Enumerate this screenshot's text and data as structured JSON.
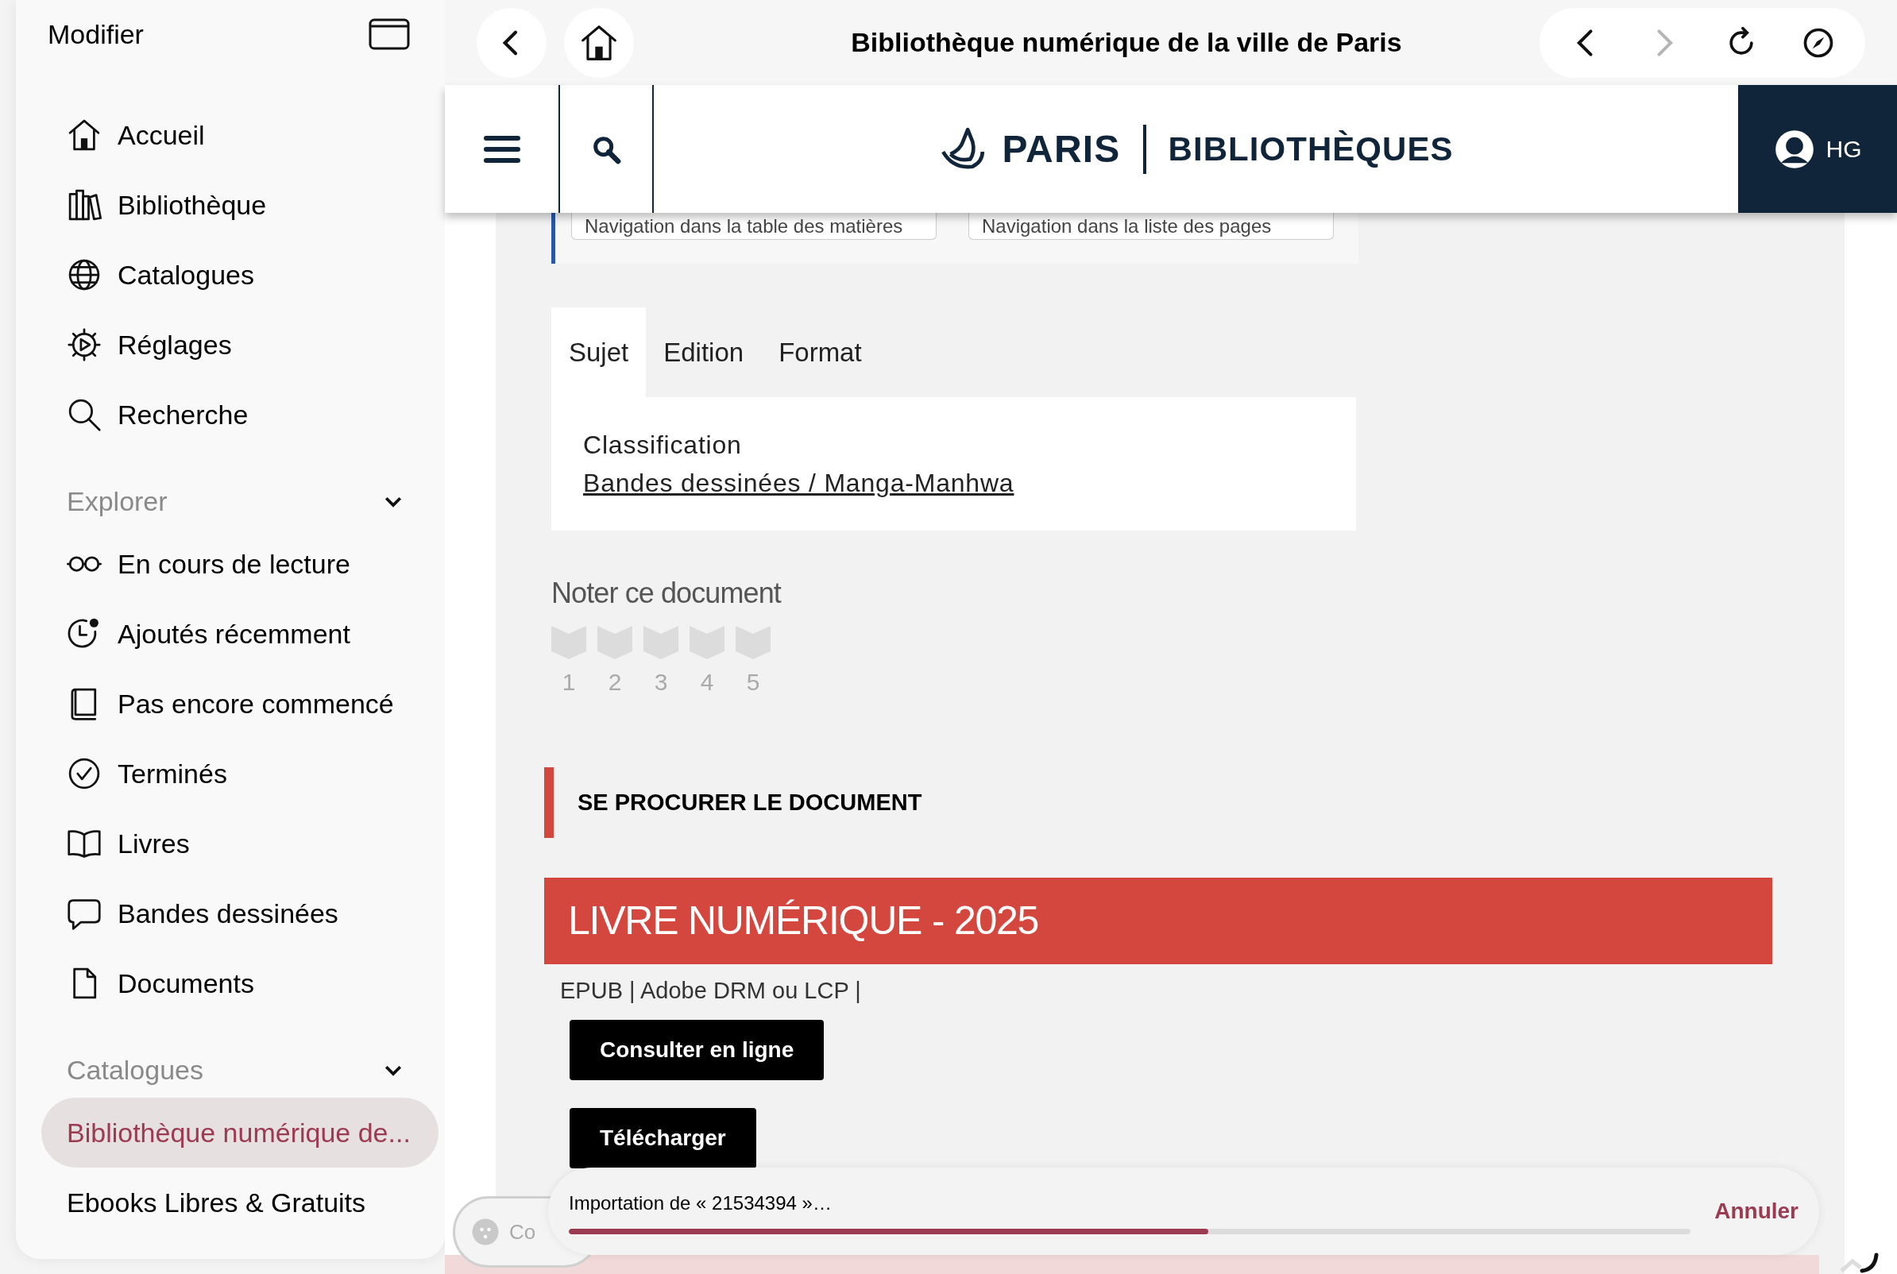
{
  "sidebar": {
    "edit_label": "Modifier",
    "items": [
      {
        "label": "Accueil",
        "kind": "home",
        "selected": false
      },
      {
        "label": "Bibliothèque",
        "kind": "library",
        "selected": false
      },
      {
        "label": "Catalogues",
        "kind": "globe",
        "selected": false
      },
      {
        "label": "Réglages",
        "kind": "gear",
        "selected": false
      },
      {
        "label": "Recherche",
        "kind": "search",
        "selected": false
      }
    ],
    "sections": [
      {
        "title": "Explorer",
        "expanded": true,
        "items": [
          {
            "label": "En cours de lecture",
            "kind": "glasses",
            "selected": false
          },
          {
            "label": "Ajoutés récemment",
            "kind": "clock",
            "selected": false
          },
          {
            "label": "Pas encore commencé",
            "kind": "book",
            "selected": false
          },
          {
            "label": "Terminés",
            "kind": "check",
            "selected": false
          },
          {
            "label": "Livres",
            "kind": "open-book",
            "selected": false
          },
          {
            "label": "Bandes dessinées",
            "kind": "bubble",
            "selected": false
          },
          {
            "label": "Documents",
            "kind": "document",
            "selected": false
          }
        ]
      },
      {
        "title": "Catalogues",
        "expanded": true,
        "items": [
          {
            "label": "Bibliothèque numérique de...",
            "kind": "text",
            "selected": true
          },
          {
            "label": "Ebooks Libres & Gratuits",
            "kind": "text",
            "selected": false
          }
        ]
      }
    ]
  },
  "browser": {
    "title": "Bibliothèque numérique de la ville de Paris",
    "nav": [
      {
        "kind": "back",
        "disabled": false
      },
      {
        "kind": "forward",
        "disabled": true
      },
      {
        "kind": "reload",
        "disabled": false
      },
      {
        "kind": "compass",
        "disabled": false
      }
    ]
  },
  "site_header": {
    "logo_left": "PARIS",
    "logo_right": "BIBLIOTHÈQUES",
    "user_initials": "HG"
  },
  "page": {
    "nav_buttons": [
      "Navigation dans la table des matières",
      "Navigation dans la liste des pages"
    ],
    "tabs": [
      {
        "label": "Sujet",
        "selected": true
      },
      {
        "label": "Edition",
        "selected": false
      },
      {
        "label": "Format",
        "selected": false
      }
    ],
    "fields": [
      {
        "label": "Classification",
        "value": "Bandes dessinées / Manga-Manhwa"
      }
    ],
    "rating": {
      "title": "Noter ce document",
      "stars": 0,
      "labels": [
        "1",
        "2",
        "3",
        "4",
        "5"
      ]
    },
    "section_title": "SE PROCURER LE DOCUMENT",
    "offer": {
      "title": "LIVRE NUMÉRIQUE - 2025",
      "format": "EPUB | Adobe DRM ou LCP |",
      "buttons": [
        "Consulter en ligne",
        "Télécharger"
      ]
    }
  },
  "chip": {
    "text": "Co"
  },
  "import": {
    "text": "Importation de « 21534394 »…",
    "level": 0.57,
    "cancel": "Annuler"
  }
}
